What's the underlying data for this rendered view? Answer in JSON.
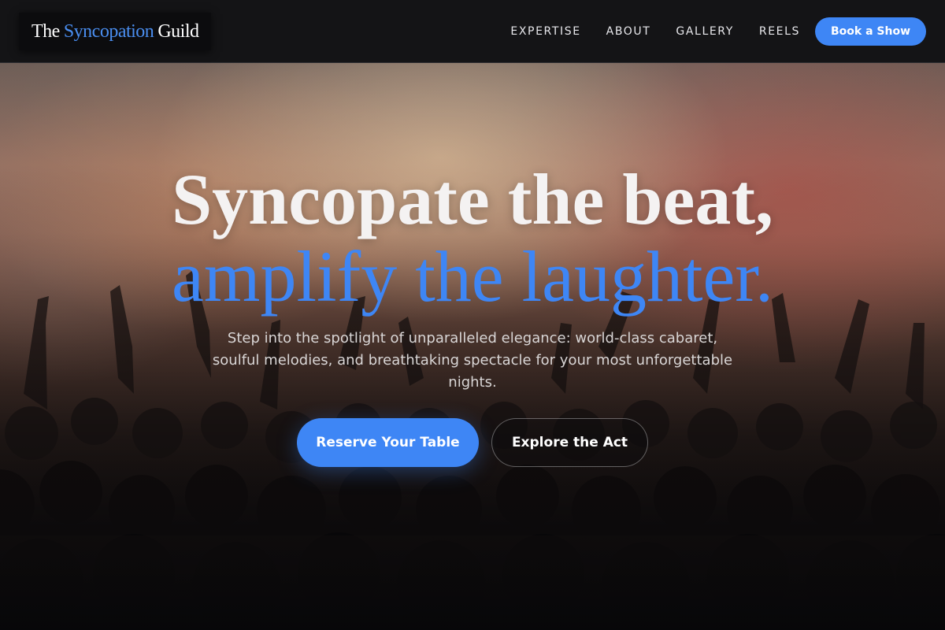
{
  "header": {
    "logo": {
      "word1": "The",
      "word2": "Syncopation",
      "word3": "Guild"
    },
    "nav": [
      {
        "label": "EXPERTISE"
      },
      {
        "label": "ABOUT"
      },
      {
        "label": "GALLERY"
      },
      {
        "label": "REELS"
      }
    ],
    "cta_label": "Book a Show"
  },
  "hero": {
    "headline_line1": "Syncopate the beat,",
    "headline_line2": "amplify the laughter.",
    "subtext": "Step into the spotlight of unparalleled elegance: world-class cabaret, soulful melodies, and breathtaking spectacle for your most unforgettable nights.",
    "primary_button": "Reserve Your Table",
    "secondary_button": "Explore the Act"
  },
  "colors": {
    "accent": "#3e86f5",
    "header_bg": "#141416",
    "text": "#ffffff"
  }
}
